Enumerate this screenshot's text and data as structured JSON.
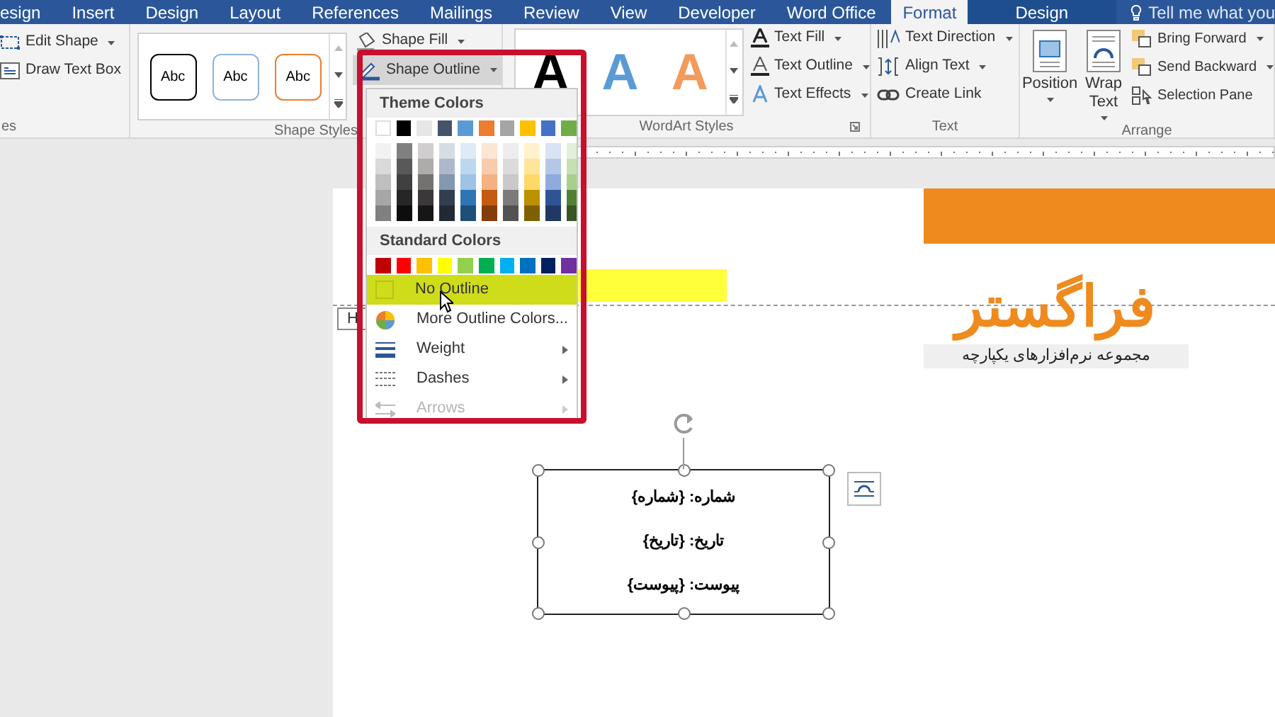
{
  "tabs": [
    {
      "label": "esign",
      "selected": false,
      "kind": "tab"
    },
    {
      "label": "Insert",
      "selected": false,
      "kind": "tab"
    },
    {
      "label": "Design",
      "selected": false,
      "kind": "tab"
    },
    {
      "label": "Layout",
      "selected": false,
      "kind": "tab"
    },
    {
      "label": "References",
      "selected": false,
      "kind": "tab"
    },
    {
      "label": "Mailings",
      "selected": false,
      "kind": "tab"
    },
    {
      "label": "Review",
      "selected": false,
      "kind": "tab"
    },
    {
      "label": "View",
      "selected": false,
      "kind": "tab"
    },
    {
      "label": "Developer",
      "selected": false,
      "kind": "tab"
    },
    {
      "label": "Word Office",
      "selected": false,
      "kind": "tab"
    },
    {
      "label": "Format",
      "selected": true,
      "kind": "tab"
    },
    {
      "label": "Design",
      "selected": false,
      "kind": "context"
    }
  ],
  "tell_me": {
    "placeholder": "Tell me what you"
  },
  "insert_shapes": {
    "items": [
      {
        "label": "Edit Shape",
        "dropdown": true
      },
      {
        "label": "Draw Text Box",
        "dropdown": false
      }
    ],
    "label": "es"
  },
  "shape_styles": {
    "presets": [
      {
        "text": "Abc",
        "color": "#000000"
      },
      {
        "text": "Abc",
        "color": "#8fb4de"
      },
      {
        "text": "Abc",
        "color": "#ed7d31"
      }
    ],
    "fill": {
      "label": "Shape Fill"
    },
    "outline": {
      "label": "Shape Outline",
      "expanded": true
    },
    "label": "Shape Styles"
  },
  "wordart_styles": {
    "presets": [
      {
        "text": "A",
        "color": "#000000"
      },
      {
        "text": "A",
        "color": "#5b9bd5"
      },
      {
        "text": "A",
        "color": "#f29b5c"
      }
    ],
    "commands": [
      {
        "label": "Text Fill"
      },
      {
        "label": "Text Outline"
      },
      {
        "label": "Text Effects"
      }
    ],
    "label": "WordArt Styles"
  },
  "text_group": {
    "commands": [
      {
        "label": "Text Direction",
        "dropdown": true
      },
      {
        "label": "Align Text",
        "dropdown": true
      },
      {
        "label": "Create Link",
        "dropdown": false
      }
    ],
    "label": "Text"
  },
  "arrange": {
    "large": [
      {
        "label": "Position"
      },
      {
        "label": "Wrap Text"
      }
    ],
    "commands": [
      {
        "label": "Bring Forward",
        "dropdown": true
      },
      {
        "label": "Send Backward",
        "dropdown": true
      },
      {
        "label": "Selection Pane",
        "dropdown": false
      }
    ],
    "label": "Arrange"
  },
  "outline_menu": {
    "theme_heading": "Theme Colors",
    "theme_colors": [
      {
        "color": "#ffffff",
        "shades": [
          {
            "color": "#f2f2f2"
          },
          {
            "color": "#d9d9d9"
          },
          {
            "color": "#bfbfbf"
          },
          {
            "color": "#a6a6a6"
          },
          {
            "color": "#808080"
          }
        ]
      },
      {
        "color": "#000000",
        "shades": [
          {
            "color": "#808080"
          },
          {
            "color": "#595959"
          },
          {
            "color": "#404040"
          },
          {
            "color": "#262626"
          },
          {
            "color": "#0d0d0d"
          }
        ]
      },
      {
        "color": "#e7e6e6",
        "shades": [
          {
            "color": "#d0cece"
          },
          {
            "color": "#aeabab"
          },
          {
            "color": "#757171"
          },
          {
            "color": "#3a3838"
          },
          {
            "color": "#171616"
          }
        ]
      },
      {
        "color": "#44546a",
        "shades": [
          {
            "color": "#d6dce4"
          },
          {
            "color": "#adb9ca"
          },
          {
            "color": "#8497b0"
          },
          {
            "color": "#333f4f"
          },
          {
            "color": "#222a35"
          }
        ]
      },
      {
        "color": "#5b9bd5",
        "shades": [
          {
            "color": "#deebf6"
          },
          {
            "color": "#bdd7ee"
          },
          {
            "color": "#9dc3e6"
          },
          {
            "color": "#2e75b5"
          },
          {
            "color": "#1f4e79"
          }
        ]
      },
      {
        "color": "#ed7d31",
        "shades": [
          {
            "color": "#fbe5d5"
          },
          {
            "color": "#f8cbad"
          },
          {
            "color": "#f4b183"
          },
          {
            "color": "#c55a11"
          },
          {
            "color": "#843c0b"
          }
        ]
      },
      {
        "color": "#a5a5a5",
        "shades": [
          {
            "color": "#ededed"
          },
          {
            "color": "#dbdbdb"
          },
          {
            "color": "#c9c9c9"
          },
          {
            "color": "#7b7b7b"
          },
          {
            "color": "#525252"
          }
        ]
      },
      {
        "color": "#ffc000",
        "shades": [
          {
            "color": "#fff2cc"
          },
          {
            "color": "#fee599"
          },
          {
            "color": "#ffd966"
          },
          {
            "color": "#bf9000"
          },
          {
            "color": "#7f6000"
          }
        ]
      },
      {
        "color": "#4472c4",
        "shades": [
          {
            "color": "#dae3f3"
          },
          {
            "color": "#b4c7e7"
          },
          {
            "color": "#8faadc"
          },
          {
            "color": "#2f5496"
          },
          {
            "color": "#1f3864"
          }
        ]
      },
      {
        "color": "#70ad47",
        "shades": [
          {
            "color": "#e2efd9"
          },
          {
            "color": "#c5e0b3"
          },
          {
            "color": "#a8d08d"
          },
          {
            "color": "#538135"
          },
          {
            "color": "#375623"
          }
        ]
      }
    ],
    "standard_heading": "Standard Colors",
    "standard_colors": [
      {
        "color": "#c00000"
      },
      {
        "color": "#ff0000"
      },
      {
        "color": "#ffc000"
      },
      {
        "color": "#ffff00"
      },
      {
        "color": "#92d050"
      },
      {
        "color": "#00b050"
      },
      {
        "color": "#00b0f0"
      },
      {
        "color": "#0070c0"
      },
      {
        "color": "#002060"
      },
      {
        "color": "#7030a0"
      }
    ],
    "items": [
      {
        "label": "No Outline",
        "selected": true,
        "submenu": false,
        "disabled": false
      },
      {
        "label": "More Outline Colors...",
        "selected": false,
        "submenu": false,
        "disabled": false
      },
      {
        "label": "Weight",
        "selected": false,
        "submenu": true,
        "disabled": false
      },
      {
        "label": "Dashes",
        "selected": false,
        "submenu": true,
        "disabled": false
      },
      {
        "label": "Arrows",
        "selected": false,
        "submenu": true,
        "disabled": true
      }
    ]
  },
  "document": {
    "header_tag": "H",
    "logo": {
      "title": "فراگستر",
      "subtitle": "مجموعه نرم‌افزارهای یکپارچه"
    },
    "text_box": {
      "lines": [
        "شماره: {شماره}",
        "تاریخ: {تاریخ}",
        "پیوست: {پیوست}"
      ]
    }
  }
}
